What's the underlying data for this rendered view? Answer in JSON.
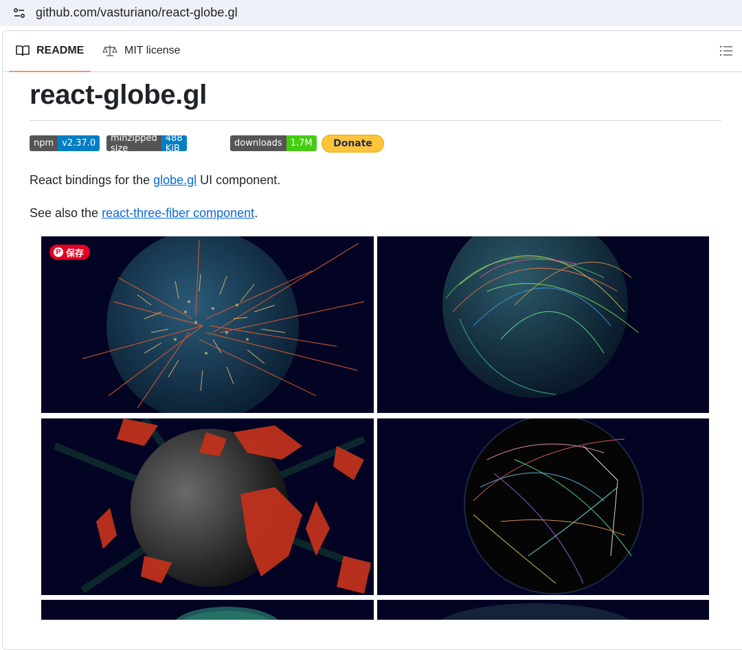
{
  "browser": {
    "url": "github.com/vasturiano/react-globe.gl"
  },
  "tabs": {
    "readme": "README",
    "license": "MIT license"
  },
  "readme": {
    "title": "react-globe.gl",
    "badges": [
      {
        "key": "npm",
        "value": "v2.37.0",
        "color": "#007ec6"
      },
      {
        "key": "minzipped size",
        "value": "488 KiB",
        "color": "#007ec6"
      },
      {
        "key": "downloads",
        "value": "1.7M",
        "color": "#44cc11"
      }
    ],
    "donate": "Donate",
    "intro": {
      "before": "React bindings for the ",
      "link": "globe.gl",
      "after": " UI component."
    },
    "see_also": {
      "before": "See also the ",
      "link": "react-three-fiber component",
      "after": "."
    },
    "pin_button": "保存"
  },
  "colors": {
    "accent": "#fd8c73",
    "link": "#0969da",
    "pinterest": "#e60023",
    "donate": "#ffc439"
  }
}
